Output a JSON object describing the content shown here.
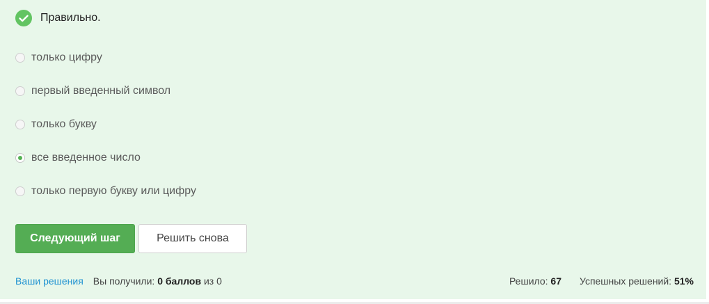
{
  "status": {
    "icon": "check-icon",
    "text": "Правильно."
  },
  "options": [
    {
      "label": "только цифру",
      "selected": false
    },
    {
      "label": "первый введенный символ",
      "selected": false
    },
    {
      "label": "только букву",
      "selected": false
    },
    {
      "label": "все введенное число",
      "selected": true
    },
    {
      "label": "только первую букву или цифру",
      "selected": false
    }
  ],
  "buttons": {
    "next": "Следующий шаг",
    "retry": "Решить снова"
  },
  "footer": {
    "your_solutions": "Ваши решения",
    "received_prefix": "Вы получили:",
    "received_score": "0 баллов",
    "received_suffix": "из 0",
    "solved_label": "Решило:",
    "solved_value": "67",
    "success_label": "Успешных решений:",
    "success_value": "51%"
  },
  "colors": {
    "panel_bg": "#e8f7ea",
    "accent_green": "#54ad54",
    "link_blue": "#1f92d1"
  }
}
